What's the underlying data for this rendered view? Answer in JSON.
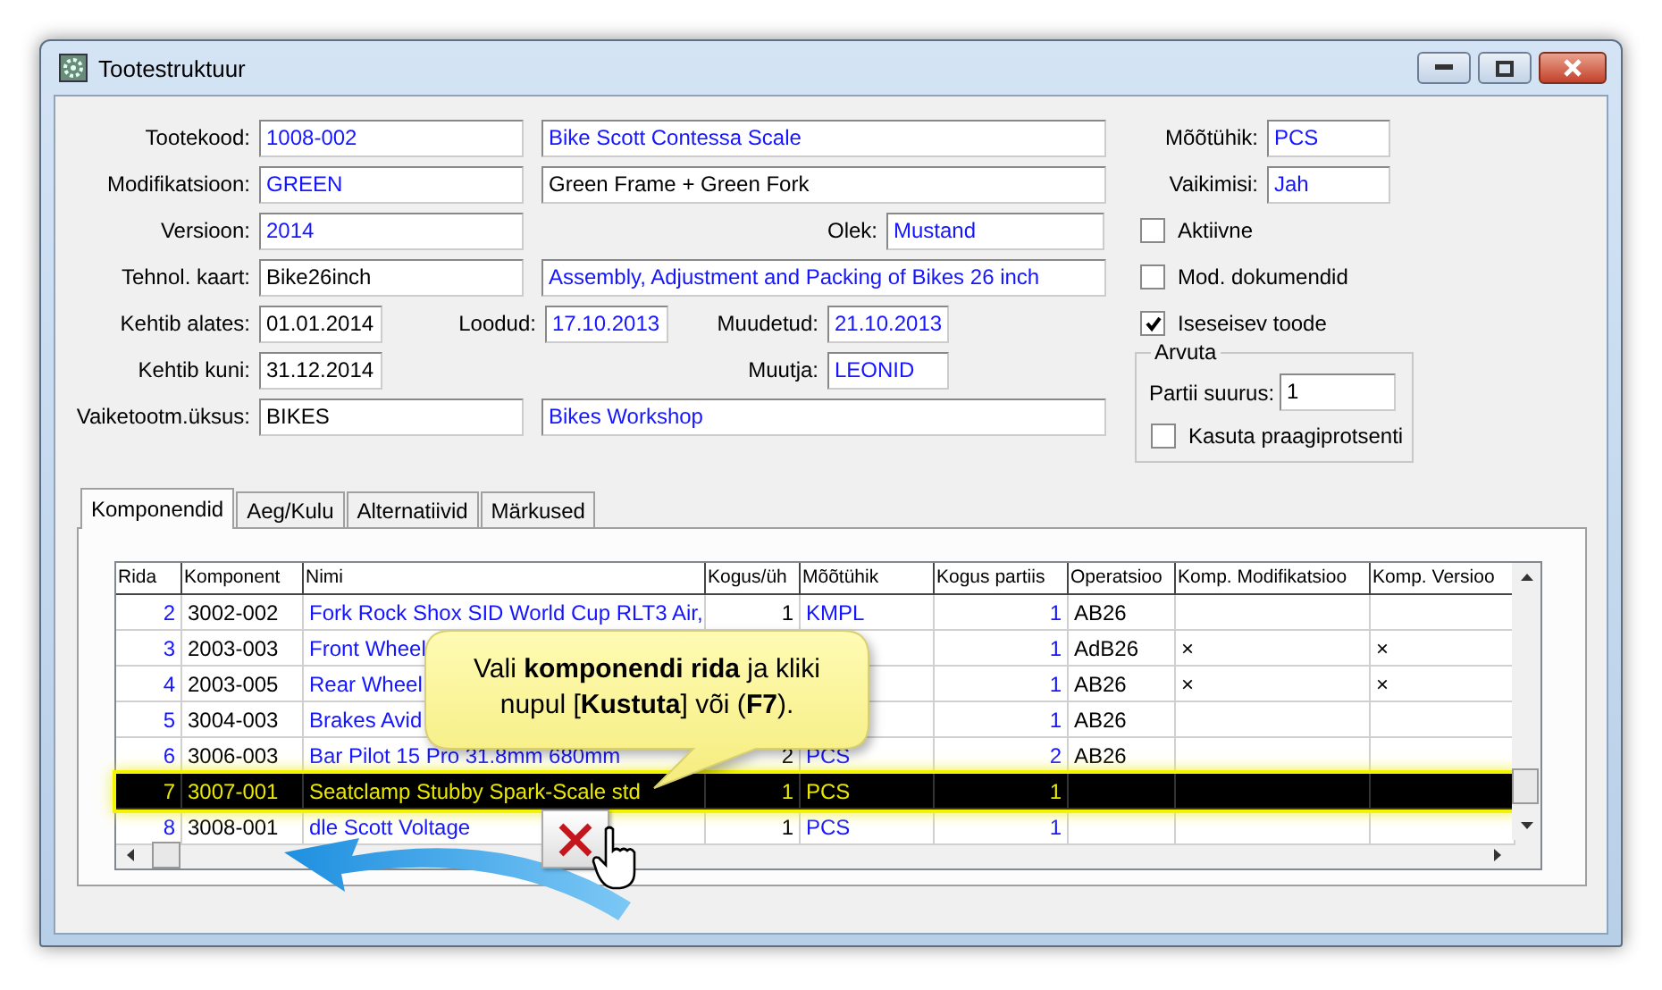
{
  "window": {
    "title": "Tootestruktuur"
  },
  "form": {
    "rows": [
      {
        "kind": "pair",
        "items": [
          {
            "kind": "label",
            "text": "Tootekood:"
          },
          {
            "kind": "field",
            "value": "1008-002",
            "linked": true
          },
          {
            "kind": "field",
            "value": "Bike Scott Contessa Scale",
            "linked": true
          }
        ]
      },
      {
        "kind": "pair",
        "items": [
          {
            "kind": "label",
            "text": "Modifikatsioon:"
          },
          {
            "kind": "field",
            "value": "GREEN",
            "linked": true
          },
          {
            "kind": "field",
            "value": "Green Frame + Green Fork",
            "linked": false
          }
        ]
      },
      {
        "kind": "status",
        "items": [
          {
            "kind": "label",
            "text": "Versioon:"
          },
          {
            "kind": "field",
            "value": "2014",
            "linked": true
          },
          {
            "kind": "label",
            "text": "Olek:"
          },
          {
            "kind": "field",
            "value": "Mustand",
            "linked": true
          }
        ]
      },
      {
        "kind": "pair",
        "items": [
          {
            "kind": "label",
            "text": "Tehnol. kaart:"
          },
          {
            "kind": "field",
            "value": "Bike26inch",
            "linked": false
          },
          {
            "kind": "field",
            "value": "Assembly, Adjustment and Packing of Bikes 26 inch",
            "linked": true
          }
        ]
      },
      {
        "kind": "dates",
        "items": [
          {
            "kind": "label",
            "text": "Kehtib alates:"
          },
          {
            "kind": "field",
            "value": "01.01.2014",
            "linked": false
          },
          {
            "kind": "label",
            "text": "Loodud:"
          },
          {
            "kind": "field",
            "value": "17.10.2013",
            "linked": true
          },
          {
            "kind": "label",
            "text": "Muudetud:"
          },
          {
            "kind": "field",
            "value": "21.10.2013",
            "linked": true
          }
        ]
      },
      {
        "kind": "author",
        "items": [
          {
            "kind": "label",
            "text": "Kehtib kuni:"
          },
          {
            "kind": "field",
            "value": "31.12.2014",
            "linked": false
          },
          {
            "kind": "label",
            "text": "Muutja:"
          },
          {
            "kind": "field",
            "value": "LEONID",
            "linked": true
          }
        ]
      },
      {
        "kind": "pair",
        "items": [
          {
            "kind": "label",
            "text": "Vaiketootm.üksus:"
          },
          {
            "kind": "field",
            "value": "BIKES",
            "linked": false
          },
          {
            "kind": "field",
            "value": "Bikes Workshop",
            "linked": true
          }
        ]
      }
    ]
  },
  "side": {
    "fields": [
      {
        "label": "Mõõtühik:",
        "value": "PCS",
        "linked": true
      },
      {
        "label": "Vaikimisi:",
        "value": "Jah",
        "linked": true
      }
    ],
    "checkboxes": [
      {
        "label": "Aktiivne",
        "checked": false
      },
      {
        "label": "Mod. dokumendid",
        "checked": false
      },
      {
        "label": "Iseseisev toode",
        "checked": true
      }
    ],
    "group": {
      "title": "Arvuta",
      "field": {
        "label": "Partii suurus:",
        "value": "1",
        "linked": false
      },
      "checkbox": {
        "label": "Kasuta praagiprotsenti",
        "checked": false
      }
    }
  },
  "tabs": [
    {
      "label": "Komponendid",
      "selected": true
    },
    {
      "label": "Aeg/Kulu",
      "selected": false
    },
    {
      "label": "Alternatiivid",
      "selected": false
    },
    {
      "label": "Märkused",
      "selected": false
    }
  ],
  "grid": {
    "columns": [
      "Rida",
      "Komponent",
      "Nimi",
      "Kogus/üh",
      "Mõõtühik",
      "Kogus partiis",
      "Operatsioo",
      "Komp. Modifikatsioo",
      "Komp. Versioo"
    ],
    "rows": [
      {
        "selected": false,
        "cells": {
          "rida": "2",
          "komponent": "3002-002",
          "nimi": "Fork Rock Shox SID World Cup RLT3 Air,",
          "kogus": "1",
          "uhik": "KMPL",
          "partiis": "1",
          "operatsioon": "AB26"
        }
      },
      {
        "selected": false,
        "cells": {
          "rida": "3",
          "komponent": "2003-003",
          "nimi": "Front Wheel",
          "partiis": "1",
          "operatsioon": "AdB26",
          "mod": "×",
          "ver": "×"
        }
      },
      {
        "selected": false,
        "cells": {
          "rida": "4",
          "komponent": "2003-005",
          "nimi": "Rear Wheel",
          "partiis": "1",
          "operatsioon": "AB26",
          "mod": "×",
          "ver": "×"
        }
      },
      {
        "selected": false,
        "cells": {
          "rida": "5",
          "komponent": "3004-003",
          "nimi": "Brakes Avid",
          "partiis": "1",
          "operatsioon": "AB26"
        }
      },
      {
        "selected": false,
        "cells": {
          "rida": "6",
          "komponent": "3006-003",
          "nimi": "Bar Pilot 15 Pro 31.8mm 680mm",
          "kogus": "2",
          "uhik": "PCS",
          "partiis": "2",
          "operatsioon": "AB26"
        }
      },
      {
        "selected": true,
        "cells": {
          "rida": "7",
          "komponent": "3007-001",
          "nimi": "Seatclamp Stubby Spark-Scale std",
          "kogus": "1",
          "uhik": "PCS",
          "partiis": "1"
        }
      },
      {
        "selected": false,
        "cells": {
          "rida": "8",
          "komponent": "3008-001",
          "nimi": "dle Scott Voltage",
          "kogus": "1",
          "uhik": "PCS",
          "partiis": "1"
        }
      }
    ]
  },
  "callout": {
    "text": "Vali **komponendi rida** ja kliki nupul [**Kustuta**] või (**F7**)."
  }
}
